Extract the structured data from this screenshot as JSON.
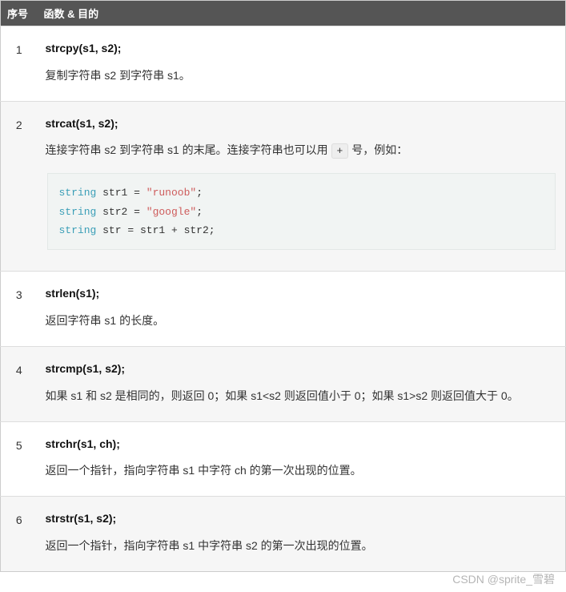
{
  "header": {
    "col_num": "序号",
    "col_desc": "函数 & 目的"
  },
  "rows": [
    {
      "num": "1",
      "sig": "strcpy(s1, s2);",
      "desc": "复制字符串 s2 到字符串 s1。"
    },
    {
      "num": "2",
      "sig": "strcat(s1, s2);",
      "desc_pre": "连接字符串 s2 到字符串 s1 的末尾。连接字符串也可以用 ",
      "inline_code": "+",
      "desc_post": " 号，例如：",
      "code": {
        "lines": [
          {
            "type": "string",
            "name": "str1",
            "op": "=",
            "rhs_str": "\"runoob\"",
            "end": ";"
          },
          {
            "type": "string",
            "name": "str2",
            "op": "=",
            "rhs_str": "\"google\"",
            "end": ";"
          },
          {
            "type": "string",
            "name": "str",
            "op": "=",
            "rhs_expr": "str1 + str2",
            "end": ";"
          }
        ]
      }
    },
    {
      "num": "3",
      "sig": "strlen(s1);",
      "desc": "返回字符串 s1 的长度。"
    },
    {
      "num": "4",
      "sig": "strcmp(s1, s2);",
      "desc": "如果 s1 和 s2 是相同的，则返回 0；如果 s1<s2 则返回值小于 0；如果 s1>s2 则返回值大于 0。"
    },
    {
      "num": "5",
      "sig": "strchr(s1, ch);",
      "desc": "返回一个指针，指向字符串 s1 中字符 ch 的第一次出现的位置。"
    },
    {
      "num": "6",
      "sig": "strstr(s1, s2);",
      "desc": "返回一个指针，指向字符串 s1 中字符串 s2 的第一次出现的位置。"
    }
  ],
  "watermark": "CSDN @sprite_雪碧"
}
